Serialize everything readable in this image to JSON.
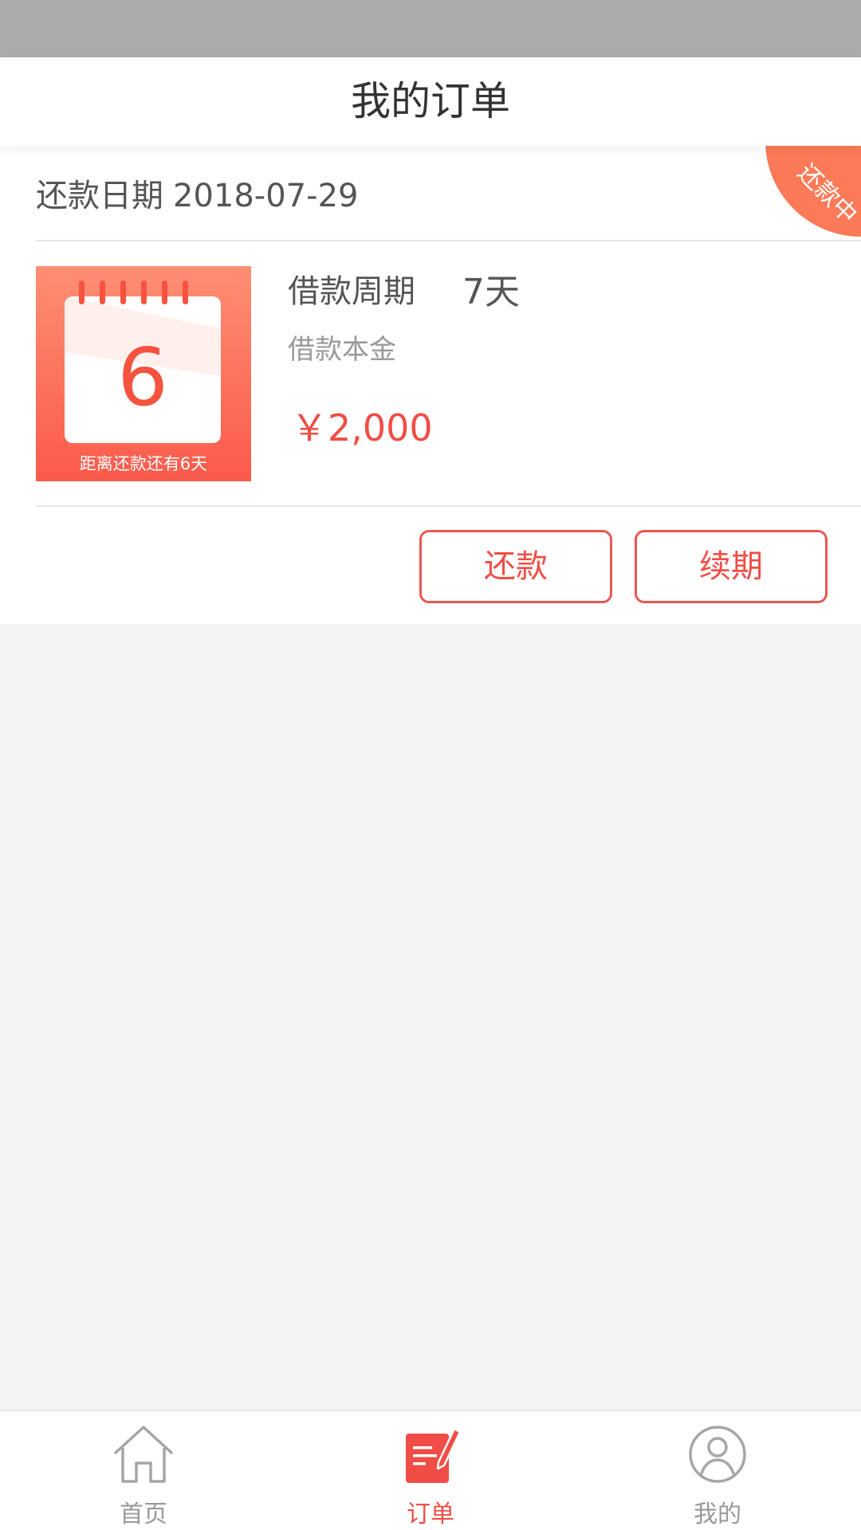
{
  "header": {
    "title": "我的订单"
  },
  "order": {
    "due_date_label": "还款日期",
    "due_date": "2018-07-29",
    "status_badge": "还款中",
    "calendar": {
      "day_number": "6",
      "caption": "距离还款还有6天"
    },
    "loan_period_label": "借款周期",
    "loan_period_value": "7天",
    "principal_label": "借款本金",
    "principal_value": "￥2,000",
    "actions": {
      "repay_label": "还款",
      "renew_label": "续期"
    }
  },
  "tab_bar": {
    "items": [
      {
        "label": "首页",
        "icon": "home-icon"
      },
      {
        "label": "订单",
        "icon": "order-icon"
      },
      {
        "label": "我的",
        "icon": "profile-icon"
      }
    ],
    "active_index": 1
  },
  "colors": {
    "accent": "#f04d46",
    "badge": "#fb7a58",
    "calendar_top": "#fd8f74",
    "calendar_bottom": "#fb5a4c"
  }
}
